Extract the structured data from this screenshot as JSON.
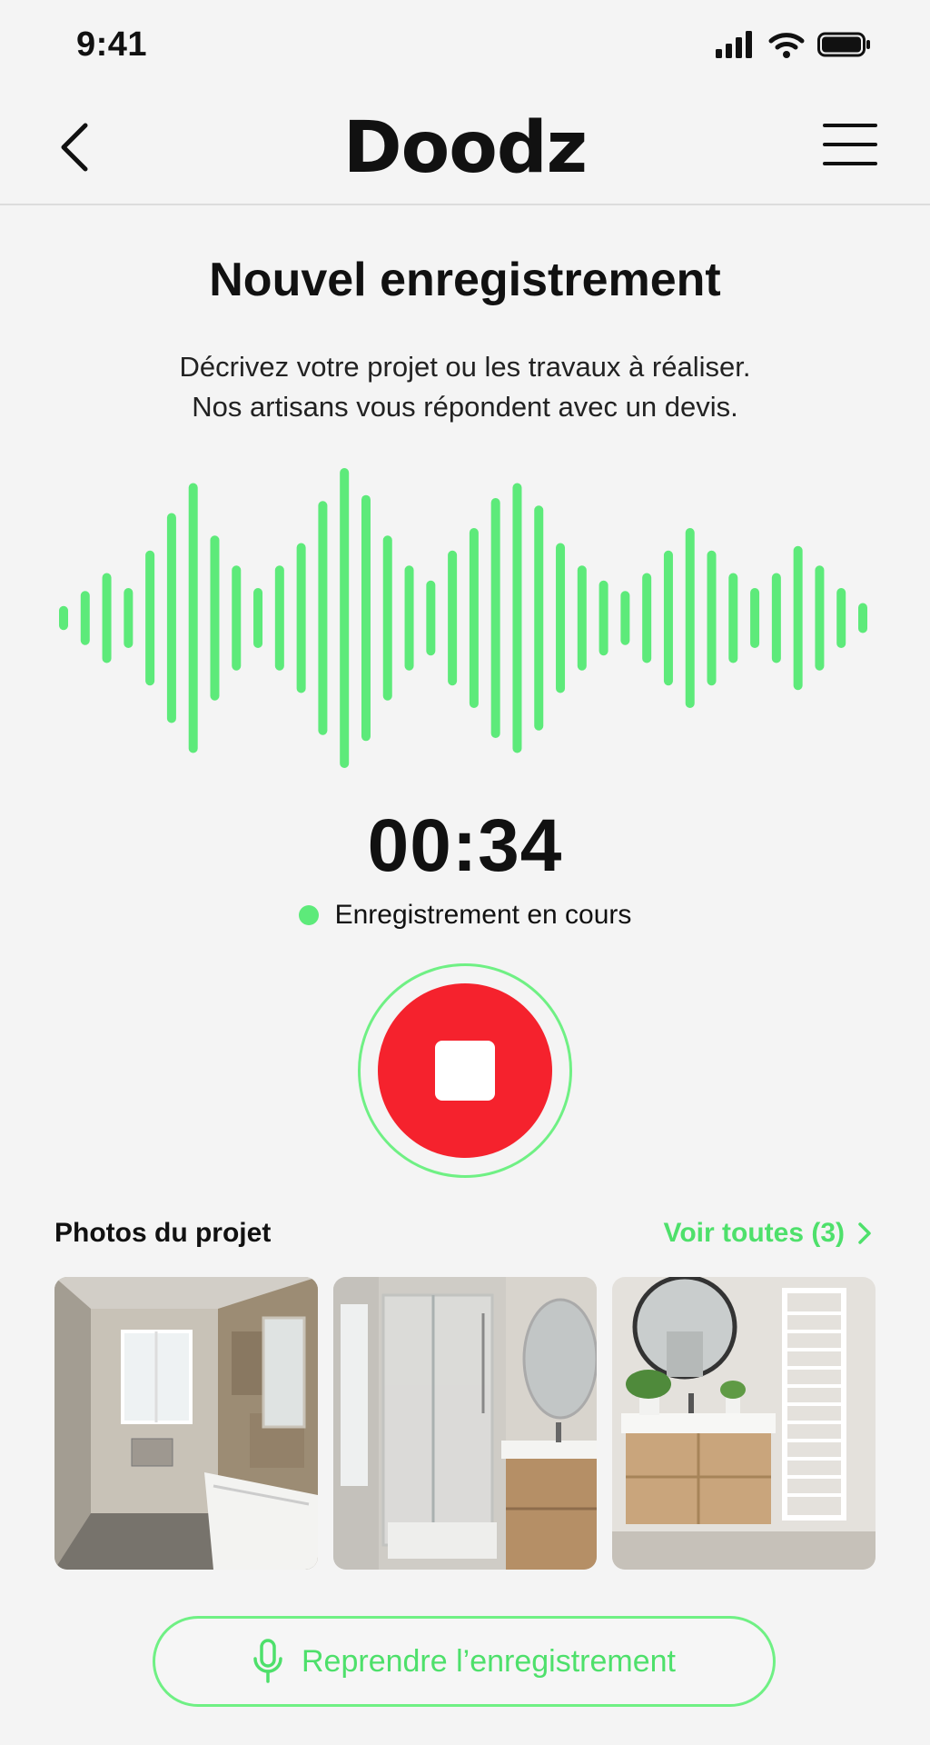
{
  "status_bar": {
    "time": "9:41"
  },
  "header": {
    "brand": "Doodz"
  },
  "page": {
    "title": "Nouvel enregistrement",
    "subtitle_line1": "Décrivez votre projet ou les travaux à réaliser.",
    "subtitle_line2": "Nos artisans vous répondent avec un devis."
  },
  "recording": {
    "timer": "00:34",
    "status": "Enregistrement en cours",
    "waveform_levels": [
      0.08,
      0.18,
      0.3,
      0.2,
      0.45,
      0.7,
      0.9,
      0.55,
      0.35,
      0.2,
      0.35,
      0.5,
      0.78,
      1.0,
      0.82,
      0.55,
      0.35,
      0.25,
      0.45,
      0.6,
      0.8,
      0.9,
      0.75,
      0.5,
      0.35,
      0.25,
      0.18,
      0.3,
      0.45,
      0.6,
      0.45,
      0.3,
      0.2,
      0.3,
      0.48,
      0.35,
      0.2,
      0.1
    ],
    "accent_color": "#5dea7a",
    "stop_color": "#f5222d"
  },
  "photos": {
    "title": "Photos du projet",
    "link_label": "Voir toutes (3)",
    "items": [
      "Salle de bain avant travaux",
      "Douche en verre",
      "Salle de bain rénovée"
    ]
  },
  "resume_button": {
    "label": "Reprendre l’enregistrement"
  }
}
